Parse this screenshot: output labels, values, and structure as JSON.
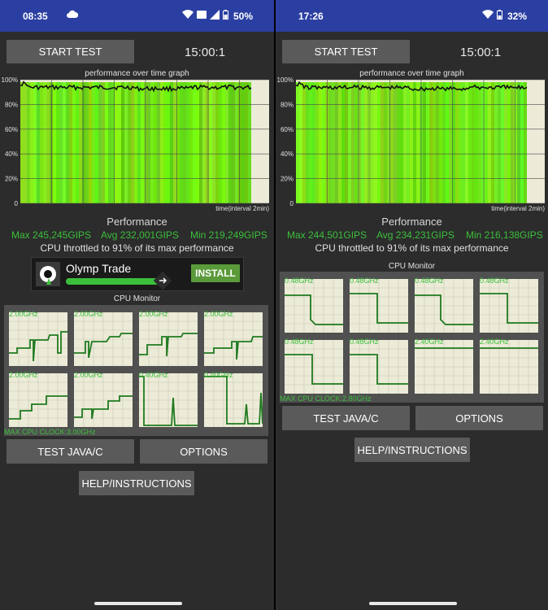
{
  "left": {
    "status": {
      "time": "08:35",
      "battery": "50%"
    },
    "start_test_label": "START TEST",
    "timer": "15:00:1",
    "graph": {
      "title": "performance over time graph",
      "y_ticks": [
        "100%",
        "80%",
        "60%",
        "40%",
        "20%",
        "0"
      ],
      "x_caption": "time(interval 2min)"
    },
    "performance": {
      "title": "Performance",
      "max": "Max 245,245GIPS",
      "avg": "Avg 232,001GIPS",
      "min": "Min 219,249GIPS",
      "throttle": "CPU throttled to 91% of its max performance"
    },
    "ad": {
      "name": "Olymp Trade",
      "install_label": "INSTALL"
    },
    "cpu_monitor": {
      "title": "CPU Monitor",
      "freqs": [
        "2.00GHz",
        "2.00GHz",
        "2.00GHz",
        "2.00GHz",
        "2.00GHz",
        "2.00GHz",
        "0.40GHz",
        "0.40GHz"
      ],
      "max_clock": "MAX CPU CLOCK:3.00GHz"
    },
    "test_java_label": "TEST JAVA/C",
    "options_label": "OPTIONS",
    "help_label": "HELP/INSTRUCTIONS"
  },
  "right": {
    "status": {
      "time": "17:26",
      "battery": "32%"
    },
    "start_test_label": "START TEST",
    "timer": "15:00:1",
    "graph": {
      "title": "performance over time graph",
      "y_ticks": [
        "100%",
        "80%",
        "60%",
        "40%",
        "20%",
        "0"
      ],
      "x_caption": "time(interval 2min)"
    },
    "performance": {
      "title": "Performance",
      "max": "Max 244,501GIPS",
      "avg": "Avg 234,231GIPS",
      "min": "Min 216,138GIPS",
      "throttle": "CPU throttled to 91% of its max performance"
    },
    "cpu_monitor": {
      "title": "CPU Monitor",
      "freqs": [
        "0.48GHz",
        "0.48GHz",
        "0.48GHz",
        "0.48GHz",
        "0.48GHz",
        "0.48GHz",
        "2.40GHz",
        "2.40GHz"
      ],
      "max_clock": "MAX CPU CLOCK:2.80GHz"
    },
    "test_java_label": "TEST JAVA/C",
    "options_label": "OPTIONS",
    "help_label": "HELP/INSTRUCTIONS"
  },
  "colors": {
    "status_bar": "#2b3fa2",
    "background": "#2c2c2c",
    "accent_green": "#3bbf3b",
    "button": "#5a5a5a",
    "graph_fill": "#66e61a"
  },
  "icons": [
    "wifi-icon",
    "signal-icon",
    "battery-icon",
    "cloud-icon",
    "ad-logo-icon",
    "arrow-icon"
  ]
}
